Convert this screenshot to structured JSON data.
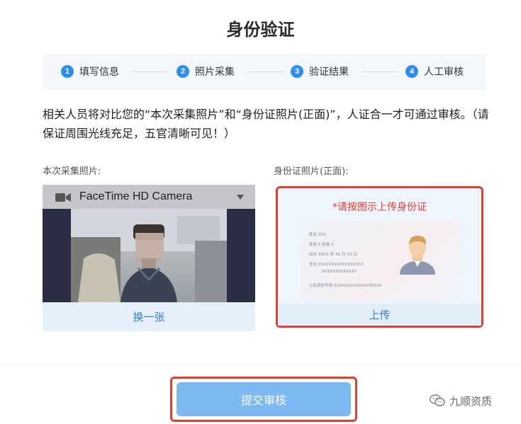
{
  "page": {
    "title": "身份验证"
  },
  "steps": [
    {
      "num": "1",
      "label": "填写信息"
    },
    {
      "num": "2",
      "label": "照片采集"
    },
    {
      "num": "3",
      "label": "验证结果"
    },
    {
      "num": "4",
      "label": "人工审核"
    }
  ],
  "notice": "相关人员将对比您的“本次采集照片”和“身份证照片(正面)”，人证合一才可通过审核。（请保证周围光线充足，五官清晰可见！）",
  "capture": {
    "label": "本次采集照片:",
    "camera_name": "FaceTime HD Camera",
    "switch_label": "换一张"
  },
  "id_photo": {
    "label": "身份证照片(正面):",
    "hint": "*请按图示上传身份证",
    "sample_fields": [
      "姓名 XXX",
      "性别 X   民族 X",
      "出生 XXXX 年 XX 月 XX 日",
      "住址 XXXXXXXXXXXXXXXXX",
      "XXXXXXXXXXXXX",
      "公民身份号码   XXXXXXXXXXXXXXXXXX"
    ],
    "upload_label": "上传"
  },
  "submit": {
    "label": "提交审核"
  },
  "watermark": {
    "text": "九顺资质"
  },
  "colors": {
    "accent": "#2e8ef0",
    "highlight_border": "#e0402c",
    "hint_red": "#e53a2e",
    "submit_bg": "#7cb8f2"
  }
}
